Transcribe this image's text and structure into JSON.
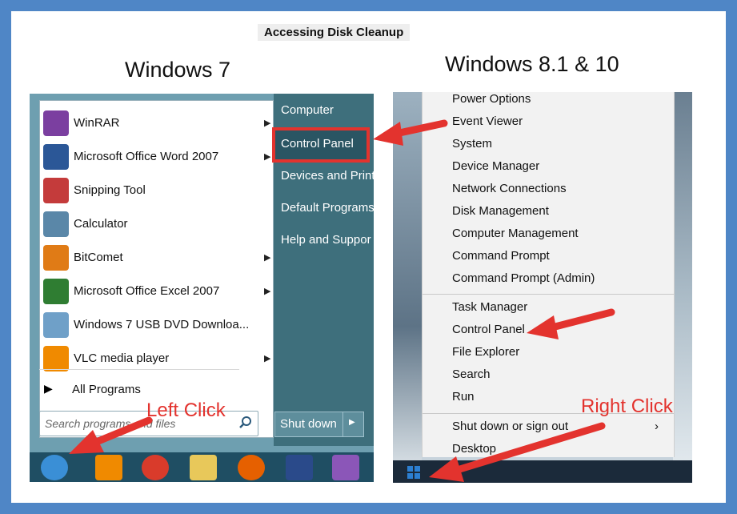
{
  "title": "Accessing Disk Cleanup",
  "win7": {
    "heading": "Windows 7",
    "programs": [
      {
        "label": "WinRAR",
        "submenu": true,
        "icon": "winrar-icon",
        "color": "#7b3fa0"
      },
      {
        "label": "Microsoft Office Word 2007",
        "submenu": true,
        "icon": "word-icon",
        "color": "#2b5797"
      },
      {
        "label": "Snipping Tool",
        "submenu": false,
        "icon": "scissors-icon",
        "color": "#c43b3b"
      },
      {
        "label": "Calculator",
        "submenu": false,
        "icon": "calculator-icon",
        "color": "#5a87a8"
      },
      {
        "label": "BitComet",
        "submenu": true,
        "icon": "bitcomet-icon",
        "color": "#e07b16"
      },
      {
        "label": "Microsoft Office Excel 2007",
        "submenu": true,
        "icon": "excel-icon",
        "color": "#2f7d32"
      },
      {
        "label": "Windows 7 USB DVD Downloa...",
        "submenu": false,
        "icon": "usb-dvd-tool-icon",
        "color": "#6fa0c8"
      },
      {
        "label": "VLC media player",
        "submenu": true,
        "icon": "vlc-icon",
        "color": "#f08a00"
      }
    ],
    "all_programs": "All Programs",
    "search_placeholder": "Search programs and files",
    "right_items": [
      "Computer",
      "Control Panel",
      "Devices and Print",
      "Default Programs",
      "Help and Suppor"
    ],
    "shutdown_label": "Shut down",
    "taskbar": [
      "start-orb-icon",
      "media-player-icon",
      "chrome-icon",
      "folder-icon",
      "firefox-icon",
      "photoshop-icon",
      "yahoo-messenger-icon"
    ]
  },
  "win8": {
    "heading": "Windows 8.1 & 10",
    "items_group1": [
      "Power Options",
      "Event Viewer",
      "System",
      "Device Manager",
      "Network Connections",
      "Disk Management",
      "Computer Management",
      "Command Prompt",
      "Command Prompt (Admin)"
    ],
    "items_group2": [
      "Task Manager",
      "Control Panel",
      "File Explorer",
      "Search",
      "Run"
    ],
    "items_group3": [
      "Shut down or sign out",
      "Desktop"
    ]
  },
  "annotations": {
    "left_click": "Left Click",
    "right_click": "Right Click"
  },
  "colors": {
    "frame": "#4f86c6",
    "annotation": "#e3332e",
    "win7_right": "#3e6f7c"
  }
}
